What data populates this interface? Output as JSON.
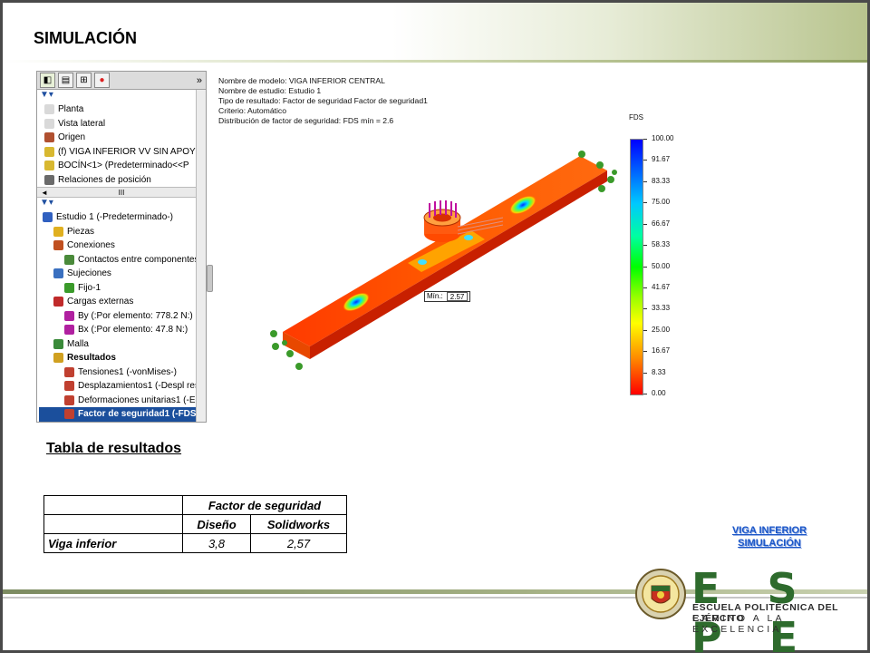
{
  "slide": {
    "title": "SIMULACIÓN"
  },
  "tree_panel": {
    "tabs": [
      "model-tab",
      "property-tab",
      "config-tab",
      "display-tab"
    ],
    "more": "»",
    "top_items": [
      {
        "label": "Planta",
        "icon": "plane-icon"
      },
      {
        "label": "Vista lateral",
        "icon": "plane-icon"
      },
      {
        "label": "Origen",
        "icon": "origin-icon"
      },
      {
        "label": "(f) VIGA INFERIOR VV SIN APOYO",
        "icon": "part-icon"
      },
      {
        "label": "BOCÍN<1> (Predeterminado<<P",
        "icon": "part-icon"
      },
      {
        "label": "Relaciones de posición",
        "icon": "mates-icon"
      }
    ],
    "scroll_thumb": "III",
    "bottom_items": [
      {
        "label": "Estudio 1 (-Predeterminado-)",
        "icon": "study-icon",
        "indent": 0
      },
      {
        "label": "Piezas",
        "icon": "parts-icon",
        "indent": 1
      },
      {
        "label": "Conexiones",
        "icon": "connections-icon",
        "indent": 1
      },
      {
        "label": "Contactos entre componentes",
        "icon": "contact-icon",
        "indent": 2
      },
      {
        "label": "Sujeciones",
        "icon": "fixture-icon",
        "indent": 1
      },
      {
        "label": "Fijo-1",
        "icon": "fixed-icon",
        "indent": 2
      },
      {
        "label": "Cargas externas",
        "icon": "loads-icon",
        "indent": 1
      },
      {
        "label": "By (:Por elemento: 778.2 N:)",
        "icon": "force-icon",
        "indent": 2
      },
      {
        "label": "Bx (:Por elemento: 47.8 N:)",
        "icon": "force-icon",
        "indent": 2
      },
      {
        "label": "Malla",
        "icon": "mesh-icon",
        "indent": 1
      },
      {
        "label": "Resultados",
        "icon": "results-icon",
        "indent": 1,
        "bold": true
      },
      {
        "label": "Tensiones1 (-vonMises-)",
        "icon": "plot-icon",
        "indent": 2
      },
      {
        "label": "Desplazamientos1 (-Despl res-)",
        "icon": "plot-icon",
        "indent": 2
      },
      {
        "label": "Deformaciones unitarias1 (-Equi",
        "icon": "plot-icon",
        "indent": 2
      },
      {
        "label": "Factor de seguridad1 (-FDS-)",
        "icon": "plot-icon",
        "indent": 2,
        "selected": true
      }
    ]
  },
  "simulation": {
    "info_lines": [
      "Nombre de modelo: VIGA INFERIOR CENTRAL",
      "Nombre de estudio: Estudio 1",
      "Tipo de resultado: Factor de seguridad Factor de seguridad1",
      "Criterio: Automático",
      "Distribución de factor de seguridad: FDS mín = 2.6"
    ],
    "legend_title": "FDS",
    "legend_ticks": [
      "100.00",
      "91.67",
      "83.33",
      "75.00",
      "66.67",
      "58.33",
      "50.00",
      "41.67",
      "33.33",
      "25.00",
      "16.67",
      "8.33",
      "0.00"
    ],
    "min_label": "Mín.:",
    "min_value": "2.57"
  },
  "results_table": {
    "heading": "Tabla de resultados",
    "group_header": "Factor de seguridad",
    "col_design": "Diseño",
    "col_solidworks": "Solidworks",
    "row_label": "Viga inferior",
    "design_value": "3,8",
    "solidworks_value": "2,57"
  },
  "nav_links": {
    "line1": "VIGA INFERIOR",
    "line2": "SIMULACIÓN"
  },
  "branding": {
    "name": "E S P E",
    "tagline1": "ESCUELA POLITÉCNICA DEL EJÉRCITO",
    "tagline2": "CAMINO A LA EXCELENCIA",
    "colors": {
      "primary": "#2e6b2d",
      "link": "#1a56c8"
    }
  }
}
